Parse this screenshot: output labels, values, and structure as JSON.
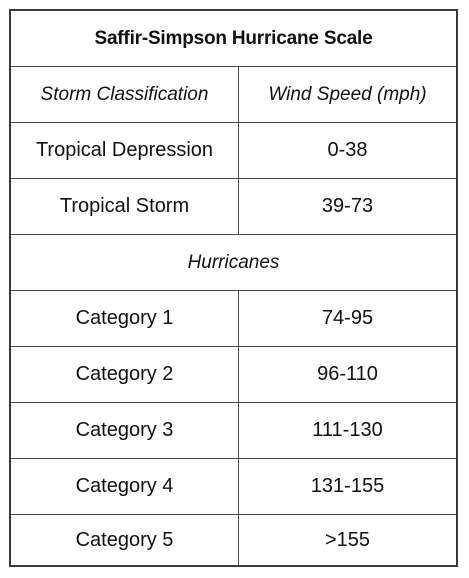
{
  "table": {
    "title": "Saffir-Simpson Hurricane Scale",
    "headers": {
      "classification": "Storm Classification",
      "wind_speed": "Wind Speed (mph)"
    },
    "rows_before": [
      {
        "classification": "Tropical Depression",
        "wind_speed": "0-38"
      },
      {
        "classification": "Tropical Storm",
        "wind_speed": "39-73"
      }
    ],
    "section_label": "Hurricanes",
    "rows_after": [
      {
        "classification": "Category 1",
        "wind_speed": "74-95"
      },
      {
        "classification": "Category 2",
        "wind_speed": "96-110"
      },
      {
        "classification": "Category 3",
        "wind_speed": "111-130"
      },
      {
        "classification": "Category 4",
        "wind_speed": "131-155"
      },
      {
        "classification": "Category 5",
        "wind_speed": ">155"
      }
    ]
  }
}
